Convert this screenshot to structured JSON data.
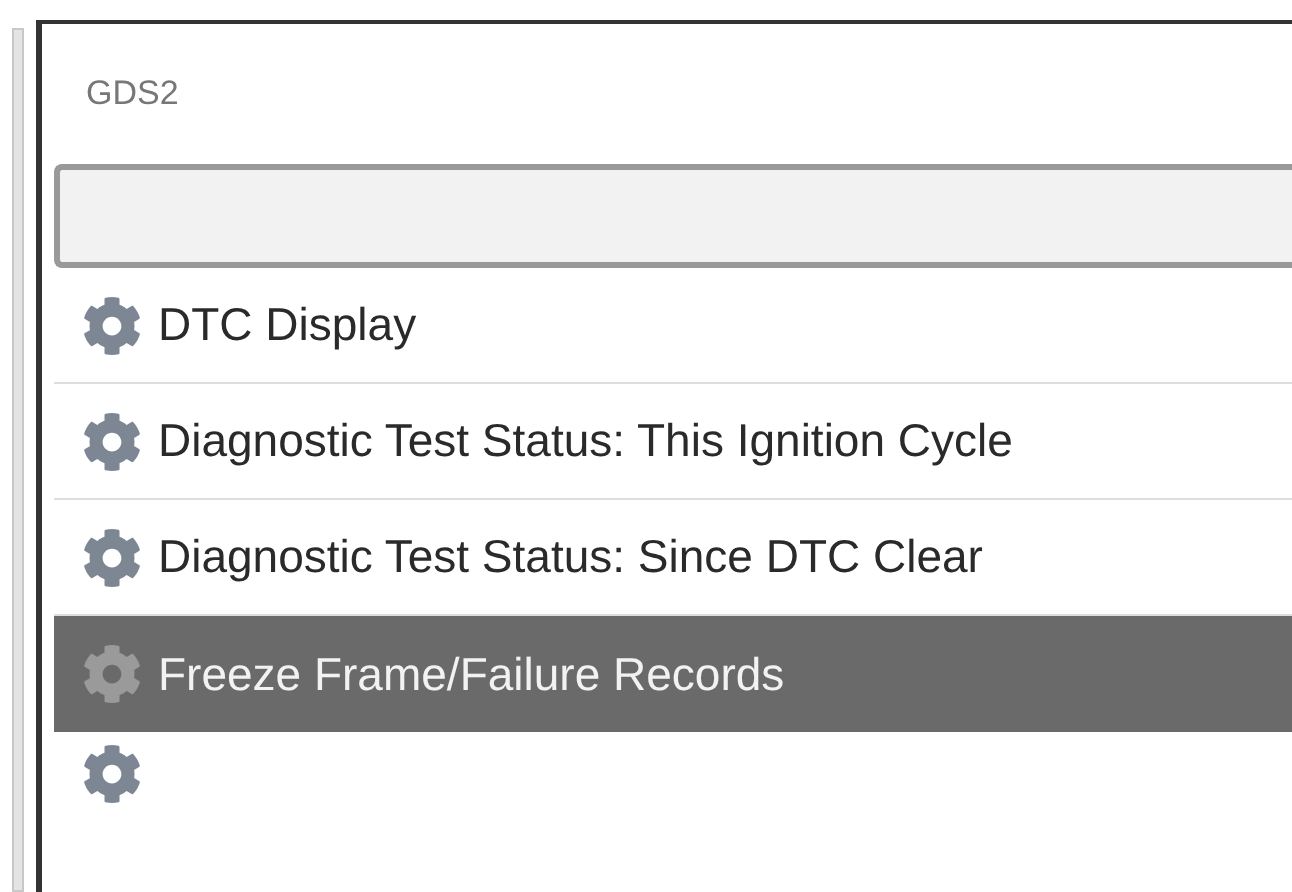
{
  "window": {
    "title": "GDS2"
  },
  "menu": {
    "items": [
      {
        "label": "DTC Display",
        "selected": false
      },
      {
        "label": "Diagnostic Test Status: This Ignition Cycle",
        "selected": false
      },
      {
        "label": "Diagnostic Test Status: Since DTC Clear",
        "selected": false
      },
      {
        "label": "Freeze Frame/Failure Records",
        "selected": true
      }
    ]
  }
}
